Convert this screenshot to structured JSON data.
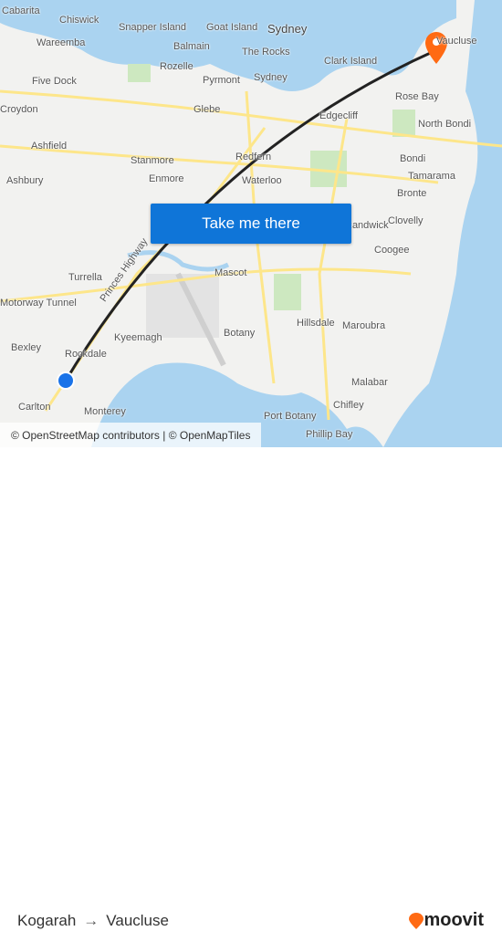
{
  "map": {
    "labels": [
      "Cabarita",
      "Chiswick",
      "Snapper Island",
      "Goat Island",
      "Sydney",
      "Wareemba",
      "Balmain",
      "The Rocks",
      "Five Dock",
      "Rozelle",
      "Pyrmont",
      "Clark Island",
      "Sydney",
      "Rose Bay",
      "Croydon",
      "Glebe",
      "Edgecliff",
      "North Bondi",
      "Ashfield",
      "Stanmore",
      "Redfern",
      "Bondi",
      "Enmore",
      "Waterloo",
      "Tamarama",
      "Ashbury",
      "Bronte",
      "Clovelly",
      "Randwick",
      "Coogee",
      "Turrella",
      "Mascot",
      "Motorway Tunnel",
      "Princes Highway",
      "Maroubra",
      "Kyeemagh",
      "Botany",
      "Hillsdale",
      "Bexley",
      "Rockdale",
      "Malabar",
      "Carlton",
      "Chifley",
      "Monterey",
      "Port Botany",
      "Phillip Bay",
      "Vaucluse"
    ],
    "colors": {
      "water": "#aad3f0",
      "land": "#f2f2f0",
      "park": "#cde8c0",
      "road": "#fde68a",
      "route": "#222222",
      "origin": "#1a73e8",
      "destination": "#ff6a13"
    }
  },
  "cta": {
    "label": "Take me there"
  },
  "attribution": "© OpenStreetMap contributors | © OpenMapTiles",
  "footer": {
    "from": "Kogarah",
    "arrow": "→",
    "to": "Vaucluse",
    "brand": "moovit"
  }
}
